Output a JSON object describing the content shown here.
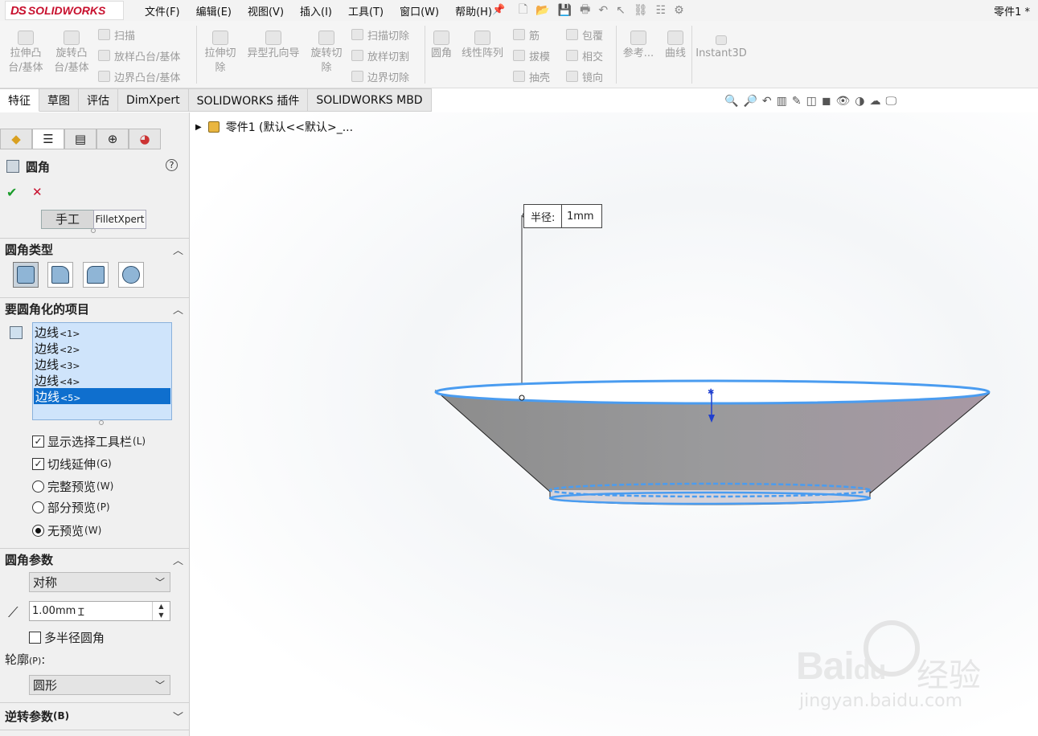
{
  "app": {
    "logo_ds": "DS",
    "logo_text": "SOLIDWORKS",
    "document_title": "零件1 *"
  },
  "menu": [
    "文件(F)",
    "编辑(E)",
    "视图(V)",
    "插入(I)",
    "工具(T)",
    "窗口(W)",
    "帮助(H)"
  ],
  "commands": {
    "extrude_boss": [
      "拉伸凸",
      "台/基体"
    ],
    "revolve_boss": [
      "旋转凸",
      "台/基体"
    ],
    "sweep": "扫描",
    "loft_boss": "放样凸台/基体",
    "boundary_boss": "边界凸台/基体",
    "extrude_cut": [
      "拉伸切",
      "除"
    ],
    "hole_wizard": "异型孔向导",
    "revolve_cut": [
      "旋转切",
      "除"
    ],
    "swept_cut": "扫描切除",
    "lofted_cut": "放样切割",
    "boundary_cut": "边界切除",
    "fillet": "圆角",
    "linear_pattern": "线性阵列",
    "rib": "筋",
    "draft": "拔模",
    "shell": "抽壳",
    "wrap": "包覆",
    "intersect": "相交",
    "mirror": "镜向",
    "reference": "参考...",
    "curves": "曲线",
    "instant3d": "Instant3D"
  },
  "tabs": [
    "特征",
    "草图",
    "评估",
    "DimXpert",
    "SOLIDWORKS 插件",
    "SOLIDWORKS MBD"
  ],
  "active_tab": 0,
  "property_manager": {
    "title": "圆角",
    "help": "?",
    "ok": "✔",
    "cancel": "✕",
    "manual_button": "手工",
    "xpert_button": "FilletXpert",
    "section_fillet_type": "圆角类型",
    "section_items": "要圆角化的项目",
    "edges": [
      {
        "name": "边线",
        "num": "<1>"
      },
      {
        "name": "边线",
        "num": "<2>"
      },
      {
        "name": "边线",
        "num": "<3>"
      },
      {
        "name": "边线",
        "num": "<4>"
      },
      {
        "name": "边线",
        "num": "<5>"
      }
    ],
    "selected_edge": 4,
    "show_selection_toolbar": {
      "label": "显示选择工具栏",
      "key": "(L)",
      "checked": true
    },
    "tangent_propagation": {
      "label": "切线延伸",
      "key": "(G)",
      "checked": true
    },
    "preview_full": {
      "label": "完整预览",
      "key": "(W)"
    },
    "preview_partial": {
      "label": "部分预览",
      "key": "(P)"
    },
    "preview_none": {
      "label": "无预览",
      "key": "(W)"
    },
    "preview_selected": "none",
    "section_params": "圆角参数",
    "symmetric": "对称",
    "radius_value": "1.00mm",
    "multi_radius": {
      "label": "多半径圆角",
      "checked": false
    },
    "profile_label": "轮廓",
    "profile_key": "(P)",
    "profile_suffix": ":",
    "profile_value": "圆形",
    "section_reverse": "逆转参数",
    "section_reverse_key": "(B)"
  },
  "graphics": {
    "tree_item": "零件1  (默认<<默认>_...",
    "callout_label": "半径:",
    "callout_value": "1mm"
  },
  "watermark": {
    "brand": "Bai",
    "brand2": "du",
    "jy": "经验",
    "url": "jingyan.baidu.com"
  }
}
